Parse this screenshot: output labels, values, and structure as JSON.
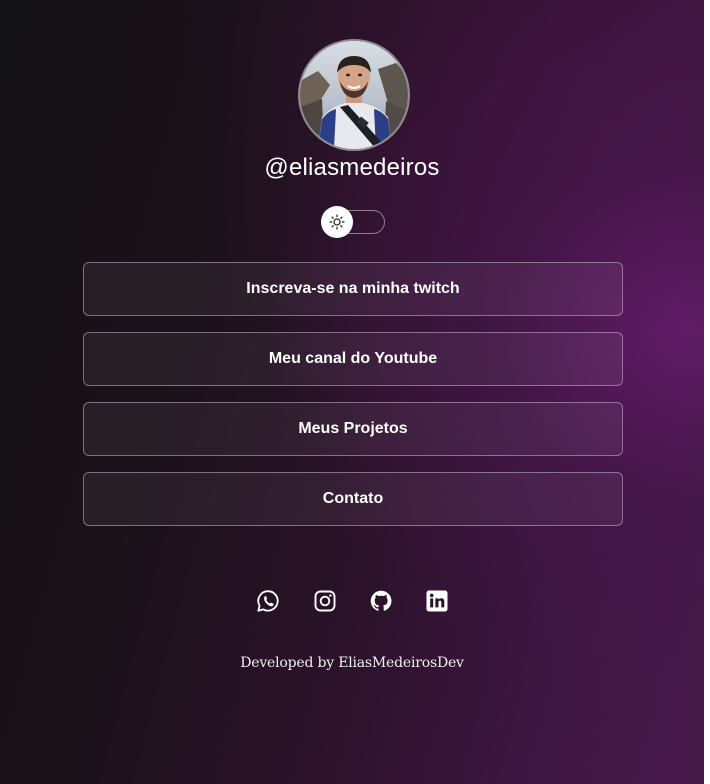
{
  "profile": {
    "username": "@eliasmedeiros",
    "avatar_alt": "profile-photo"
  },
  "theme_toggle": {
    "icon": "sun-icon",
    "state": "light"
  },
  "links": [
    {
      "label": "Inscreva-se na minha twitch"
    },
    {
      "label": "Meu canal do Youtube"
    },
    {
      "label": "Meus Projetos"
    },
    {
      "label": "Contato"
    }
  ],
  "socials": [
    {
      "icon": "whatsapp-icon"
    },
    {
      "icon": "instagram-icon"
    },
    {
      "icon": "github-icon"
    },
    {
      "icon": "linkedin-icon"
    }
  ],
  "footer": {
    "text": "Developed by EliasMedeirosDev"
  },
  "colors": {
    "background_dark": "#141316",
    "background_accent": "#621c68",
    "text": "#ffffff",
    "button_border": "#c8b4cd"
  }
}
